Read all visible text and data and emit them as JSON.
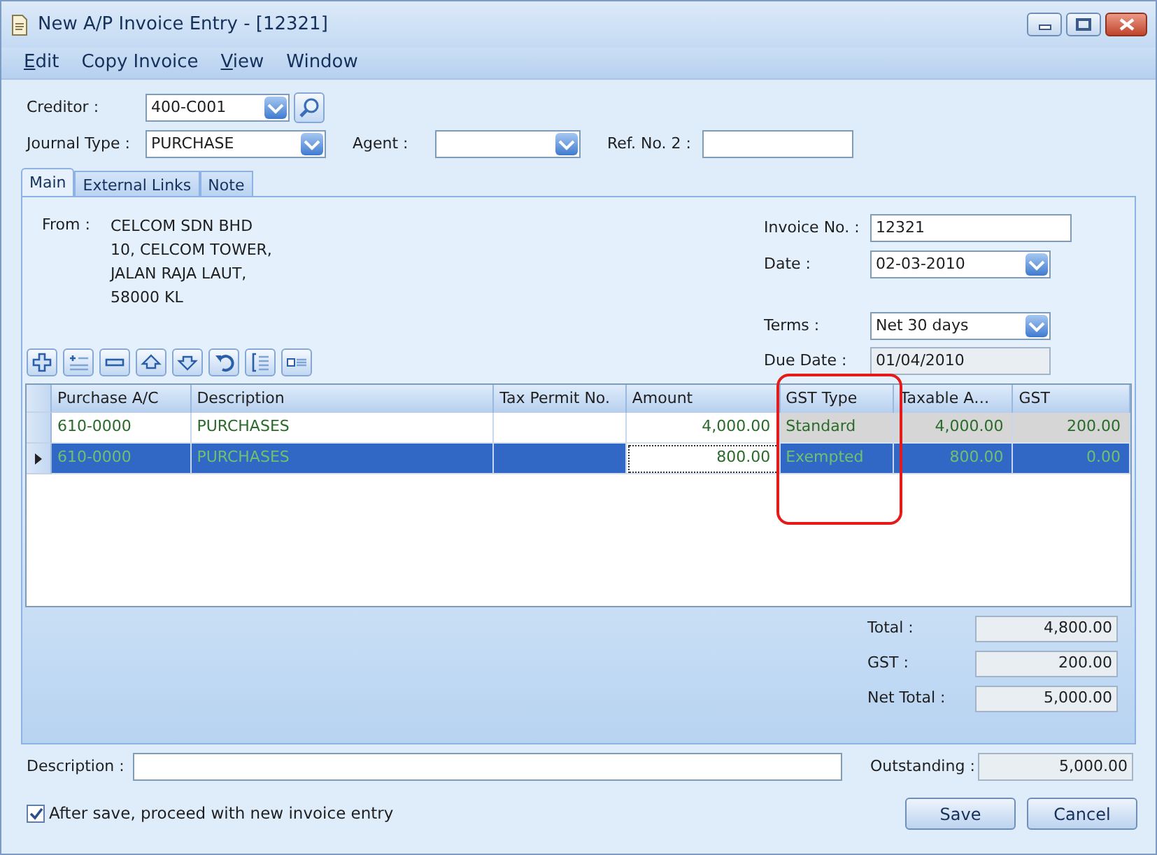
{
  "window": {
    "title": "New A/P Invoice Entry - [12321]"
  },
  "menu": [
    {
      "label": "Edit",
      "underlined": true
    },
    {
      "label": "Copy Invoice",
      "underlined": false
    },
    {
      "label": "View",
      "underlined": true
    },
    {
      "label": "Window",
      "underlined": false
    }
  ],
  "header": {
    "creditor": {
      "label": "Creditor :",
      "value": "400-C001"
    },
    "journal_type": {
      "label": "Journal Type :",
      "value": "PURCHASE"
    },
    "agent": {
      "label": "Agent :"
    },
    "ref_no_2": {
      "label": "Ref. No. 2 :"
    }
  },
  "tabs": [
    {
      "label": "Main",
      "selected": true
    },
    {
      "label": "External Links",
      "selected": false
    },
    {
      "label": "Note",
      "selected": false
    }
  ],
  "from": {
    "label": "From :",
    "lines": [
      "CELCOM SDN BHD",
      "10, CELCOM TOWER,",
      "JALAN RAJA LAUT,",
      "58000 KL"
    ]
  },
  "invoice": {
    "invoice_no": {
      "label": "Invoice No. :",
      "value": "12321"
    },
    "date": {
      "label": "Date :",
      "value": "02-03-2010"
    },
    "terms": {
      "label": "Terms :",
      "value": "Net 30 days"
    },
    "due_date": {
      "label": "Due Date :",
      "value": "01/04/2010"
    }
  },
  "toolbar": [
    {
      "kind": "add"
    },
    {
      "kind": "insert"
    },
    {
      "kind": "delete"
    },
    {
      "kind": "move-up"
    },
    {
      "kind": "move-down"
    },
    {
      "kind": "undo"
    },
    {
      "kind": "list"
    },
    {
      "kind": "detail"
    }
  ],
  "table": {
    "columns": [
      {
        "label": "Purchase A/C",
        "kind": "text",
        "readonly": false
      },
      {
        "label": "Description",
        "kind": "text",
        "readonly": false
      },
      {
        "label": "Tax Permit No.",
        "kind": "text",
        "readonly": false
      },
      {
        "label": "Amount",
        "kind": "number",
        "readonly": false
      },
      {
        "label": "GST Type",
        "kind": "text",
        "readonly": true
      },
      {
        "label": "Taxable A…",
        "kind": "number",
        "readonly": true
      },
      {
        "label": "GST",
        "kind": "number",
        "readonly": true
      }
    ],
    "rows": [
      {
        "selected": false,
        "cells": [
          {
            "text": "610-0000",
            "focused": false
          },
          {
            "text": "PURCHASES",
            "focused": false
          },
          {
            "text": "",
            "focused": false
          },
          {
            "text": "4,000.00",
            "focused": false
          },
          {
            "text": "Standard",
            "focused": false
          },
          {
            "text": "4,000.00",
            "focused": false
          },
          {
            "text": "200.00",
            "focused": false
          }
        ]
      },
      {
        "selected": true,
        "cells": [
          {
            "text": "610-0000",
            "focused": false
          },
          {
            "text": "PURCHASES",
            "focused": false
          },
          {
            "text": "",
            "focused": false
          },
          {
            "text": "800.00",
            "focused": true
          },
          {
            "text": "Exempted",
            "focused": false
          },
          {
            "text": "800.00",
            "focused": false
          },
          {
            "text": "0.00",
            "focused": false
          }
        ]
      }
    ]
  },
  "totals": [
    {
      "label": "Total :",
      "value": "4,800.00"
    },
    {
      "label": "GST :",
      "value": "200.00"
    },
    {
      "label": "Net Total :",
      "value": "5,000.00"
    }
  ],
  "description": {
    "label": "Description :"
  },
  "outstanding": {
    "label": "Outstanding :",
    "value": "5,000.00"
  },
  "proceed": {
    "label": "After save, proceed with new invoice entry",
    "checked": true
  },
  "buttons": [
    "Save",
    "Cancel"
  ]
}
